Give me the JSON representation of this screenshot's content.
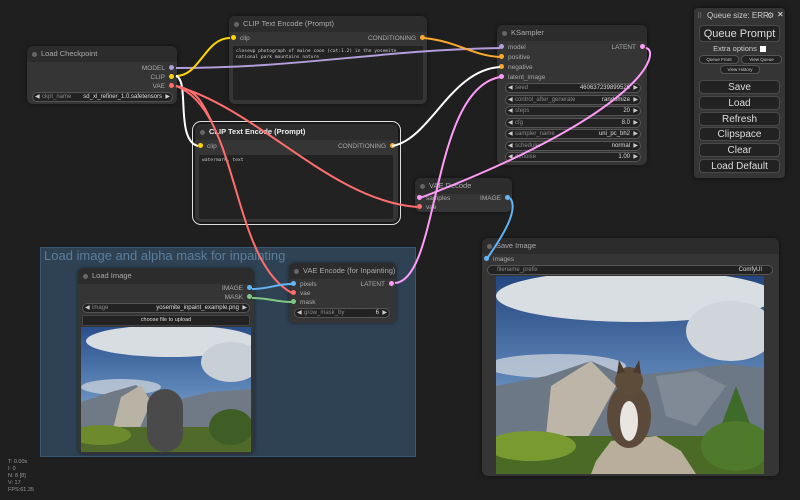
{
  "menu": {
    "queue_size": "Queue size: ERR",
    "queue_prompt": "Queue Prompt",
    "extra_options": "Extra options",
    "queue_front": "Queue Front",
    "view_queue": "View Queue",
    "view_history": "View History",
    "buttons": [
      "Save",
      "Load",
      "Refresh",
      "Clipspace",
      "Clear",
      "Load Default"
    ]
  },
  "group": {
    "title": "Load image and alpha mask for inpainting"
  },
  "nodes": {
    "load_checkpoint": {
      "title": "Load Checkpoint",
      "outputs": [
        "MODEL",
        "CLIP",
        "VAE"
      ],
      "widget": {
        "label": "ckpt_name",
        "value": "sd_xl_refiner_1.0.safetensors"
      }
    },
    "clip_pos": {
      "title": "CLIP Text Encode (Prompt)",
      "input": "clip",
      "output": "CONDITIONING",
      "text": "closeup photograph of maine coon (cat:1.2) in the yosemite national park mountains nature"
    },
    "clip_neg": {
      "title": "CLIP Text Encode (Prompt)",
      "input": "clip",
      "output": "CONDITIONING",
      "text": "watermark, text"
    },
    "ksampler": {
      "title": "KSampler",
      "inputs": [
        "model",
        "positive",
        "negative",
        "latent_image"
      ],
      "output": "LATENT",
      "widgets": [
        {
          "label": "seed",
          "value": "460637239899526"
        },
        {
          "label": "control_after_generate",
          "value": "randomize"
        },
        {
          "label": "steps",
          "value": "20"
        },
        {
          "label": "cfg",
          "value": "8.0"
        },
        {
          "label": "sampler_name",
          "value": "uni_pc_bh2"
        },
        {
          "label": "scheduler",
          "value": "normal"
        },
        {
          "label": "denoise",
          "value": "1.00"
        }
      ]
    },
    "vae_decode": {
      "title": "VAE Decode",
      "inputs": [
        "samples",
        "vae"
      ],
      "output": "IMAGE"
    },
    "load_image": {
      "title": "Load Image",
      "outputs": [
        "IMAGE",
        "MASK"
      ],
      "widget": {
        "label": "image",
        "value": "yosemite_inpaint_example.png"
      },
      "upload": "choose file to upload"
    },
    "vae_encode": {
      "title": "VAE Encode (for Inpainting)",
      "inputs": [
        "pixels",
        "vae",
        "mask"
      ],
      "output": "LATENT",
      "widget": {
        "label": "grow_mask_by",
        "value": "6"
      }
    },
    "save_image": {
      "title": "Save Image",
      "input": "images",
      "widget": {
        "label": "filename_prefix",
        "value": "ComfyUI"
      }
    }
  },
  "colors": {
    "model": "#b39ddb",
    "clip": "#ffd500",
    "vae": "#ff6e6e",
    "conditioning": "#ffa931",
    "latent": "#ff9cf9",
    "image": "#64b5f6",
    "mask": "#81c784"
  },
  "stats": [
    "T: 0.00s",
    "I: 0",
    "N: 8 [8]",
    "V: 17",
    "FPS:61.35"
  ]
}
